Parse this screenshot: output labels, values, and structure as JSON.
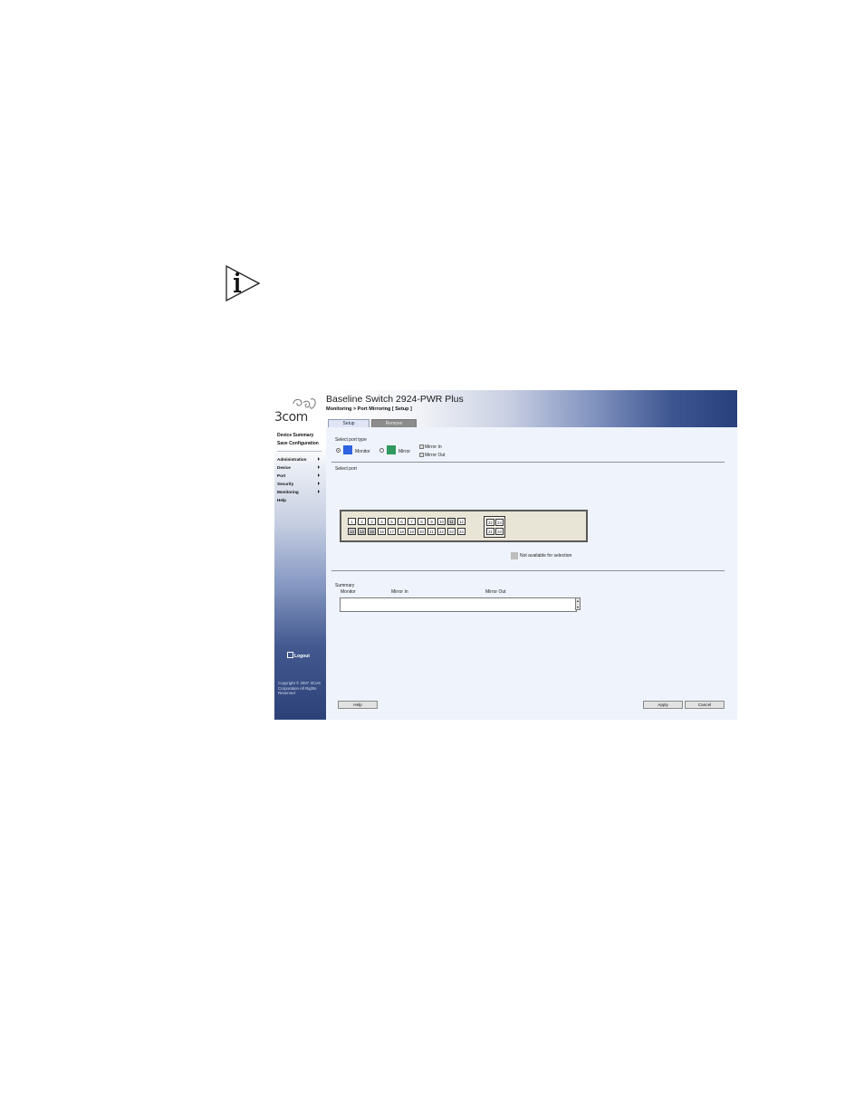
{
  "note_icon": "info-icon",
  "app": {
    "logo_text": "3com",
    "title": "Baseline Switch 2924-PWR Plus",
    "breadcrumb": "Monitoring > Port Mirroring [ Setup ]",
    "tabs": [
      {
        "label": "Setup",
        "active": true
      },
      {
        "label": "Remove",
        "active": false
      }
    ],
    "sidebar": {
      "links": [
        "Device Summary",
        "Save Configuration"
      ],
      "menu": [
        "Administration",
        "Device",
        "Port",
        "Security",
        "Monitoring",
        "Help"
      ],
      "logout": "Logout",
      "copyright": "Copyright © 2007 3Com Corporation All Rights Reserved"
    },
    "port_type": {
      "label": "Select port type",
      "options": [
        {
          "label": "Monitor",
          "selected": true,
          "color": "#2f63e0"
        },
        {
          "label": "Mirror",
          "selected": false,
          "color": "#2f9a5e"
        }
      ],
      "checkboxes": [
        "Mirror In",
        "Mirror Out"
      ]
    },
    "select_port": {
      "label": "Select port",
      "top_row": [
        "1",
        "2",
        "3",
        "4",
        "5",
        "6",
        "7",
        "8",
        "9",
        "10",
        "11",
        "12"
      ],
      "bottom_row": [
        "13",
        "14",
        "15",
        "16",
        "17",
        "18",
        "19",
        "20",
        "21",
        "22",
        "23",
        "24"
      ],
      "sfp_top": [
        "22",
        "24"
      ],
      "sfp_bottom": [
        "21",
        "23"
      ],
      "unavailable": [
        "11",
        "13",
        "14",
        "15"
      ],
      "legend": "Not available for selection"
    },
    "summary": {
      "label": "Summary",
      "columns": [
        "Monitor",
        "Mirror In",
        "Mirror Out"
      ]
    },
    "buttons": {
      "help": "Help",
      "apply": "Apply",
      "cancel": "Cancel"
    }
  }
}
